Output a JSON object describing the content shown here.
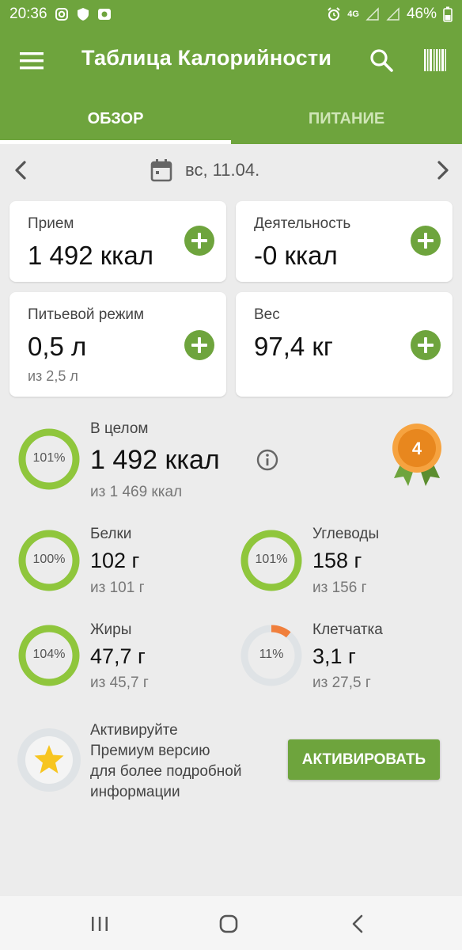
{
  "status_bar": {
    "time": "20:36",
    "network": "4G",
    "battery": "46%"
  },
  "app_bar": {
    "title": "Таблица Калорийности"
  },
  "tabs": [
    {
      "label": "ОБЗОР",
      "active": true
    },
    {
      "label": "ПИТАНИЕ",
      "active": false
    }
  ],
  "date_nav": {
    "date": "вс, 11.04."
  },
  "cards": {
    "intake": {
      "label": "Прием",
      "value": "1 492 ккал"
    },
    "activity": {
      "label": "Деятельность",
      "value": "-0 ккал"
    },
    "water": {
      "label": "Питьевой режим",
      "value": "0,5 л",
      "sub": "из 2,5 л"
    },
    "weight": {
      "label": "Вес",
      "value": "97,4 кг"
    }
  },
  "overall": {
    "title": "В целом",
    "value": "1 492 ккал",
    "sub": "из 1 469 ккал",
    "percent_label": "101%",
    "progress": 1.01,
    "badge_number": "4"
  },
  "nutrients": [
    {
      "key": "protein",
      "title": "Белки",
      "value": "102 г",
      "sub": "из 101 г",
      "percent_label": "100%",
      "progress": 1.0
    },
    {
      "key": "carbs",
      "title": "Углеводы",
      "value": "158 г",
      "sub": "из 156 г",
      "percent_label": "101%",
      "progress": 1.01
    },
    {
      "key": "fat",
      "title": "Жиры",
      "value": "47,7 г",
      "sub": "из 45,7 г",
      "percent_label": "104%",
      "progress": 1.04
    },
    {
      "key": "fiber",
      "title": "Клетчатка",
      "value": "3,1 г",
      "sub": "из 27,5 г",
      "percent_label": "11%",
      "progress": 0.11
    }
  ],
  "premium": {
    "line1": "Активируйте",
    "line2": "Премиум версию",
    "line3": "для более подробной",
    "line4": "информации",
    "button_label": "АКТИВИРОВАТЬ"
  },
  "colors": {
    "primary": "#6ea43d",
    "ring_complete": "#8fc63c",
    "ring_partial": "#f07f3c",
    "ring_track": "#dfe3e6",
    "badge": "#e8871e"
  },
  "icons": [
    "menu-icon",
    "search-icon",
    "barcode-icon",
    "calendar-icon",
    "chevron-left-icon",
    "chevron-right-icon",
    "info-icon",
    "award-badge-icon",
    "star-icon"
  ]
}
